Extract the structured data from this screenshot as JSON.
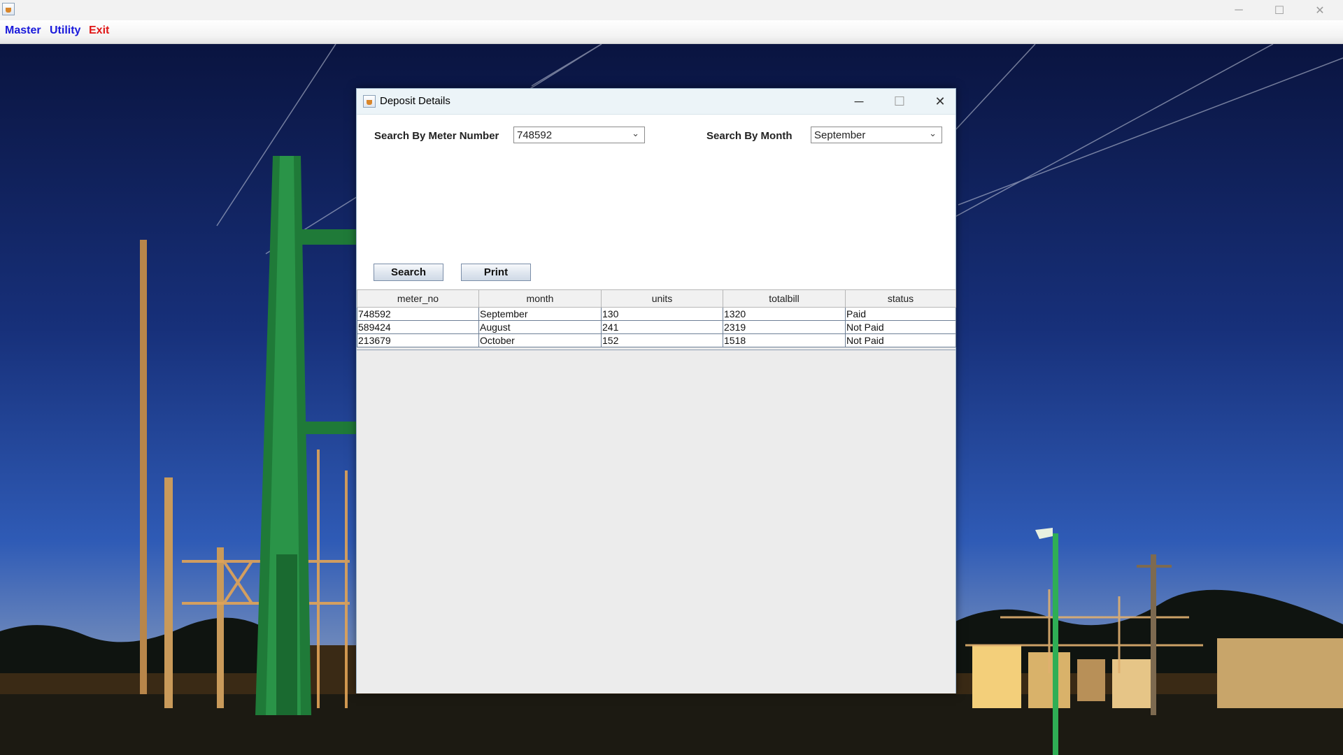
{
  "window": {
    "icon": "java-cup-icon",
    "controls": {
      "minimize": "─",
      "maximize": "☐",
      "close": "✕"
    }
  },
  "menubar": {
    "items": [
      {
        "label": "Master",
        "color": "#1a1adb"
      },
      {
        "label": "Utility",
        "color": "#1a1adb"
      },
      {
        "label": "Exit",
        "color": "#e01616"
      }
    ]
  },
  "dialog": {
    "title": "Deposit Details",
    "icon": "java-cup-icon",
    "controls": {
      "minimize": "─",
      "maximize": "☐",
      "close": "✕"
    },
    "search_meter_label": "Search By Meter Number",
    "meter_value": "748592",
    "search_month_label": "Search By Month",
    "month_value": "September",
    "search_button": "Search",
    "print_button": "Print",
    "table": {
      "columns": [
        "meter_no",
        "month",
        "units",
        "totalbill",
        "status"
      ],
      "rows": [
        [
          "748592",
          "September",
          "130",
          "1320",
          "Paid"
        ],
        [
          "589424",
          "August",
          "241",
          "2319",
          "Not Paid"
        ],
        [
          "213679",
          "October",
          "152",
          "1518",
          "Not Paid"
        ]
      ]
    }
  }
}
